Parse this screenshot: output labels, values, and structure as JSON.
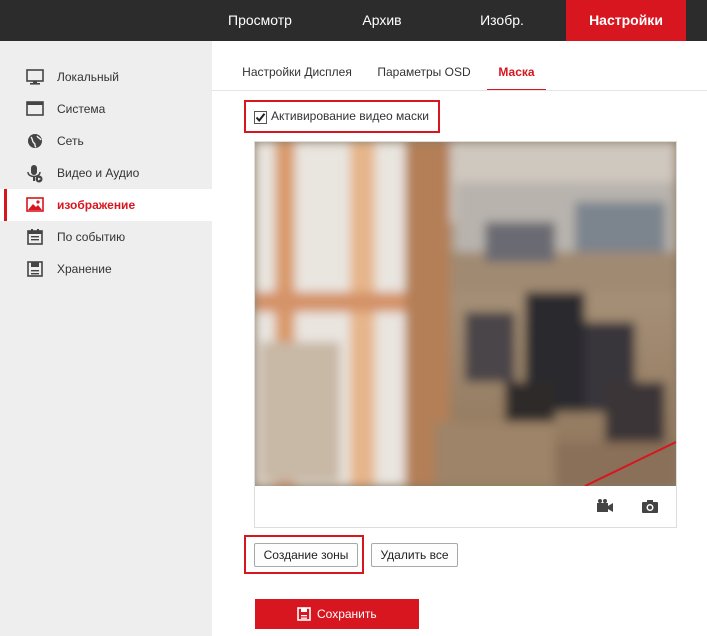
{
  "top_nav": {
    "items": [
      {
        "label": "Просмотр",
        "active": false
      },
      {
        "label": "Архив",
        "active": false
      },
      {
        "label": "Изобр.",
        "active": false
      },
      {
        "label": "Настройки",
        "active": true
      }
    ]
  },
  "sidebar": {
    "items": [
      {
        "label": "Локальный",
        "icon": "monitor-icon",
        "active": false
      },
      {
        "label": "Система",
        "icon": "window-icon",
        "active": false
      },
      {
        "label": "Сеть",
        "icon": "globe-icon",
        "active": false
      },
      {
        "label": "Видео и Аудио",
        "icon": "microphone-icon",
        "active": false
      },
      {
        "label": "изображение",
        "icon": "image-icon",
        "active": true
      },
      {
        "label": "По событию",
        "icon": "calendar-icon",
        "active": false
      },
      {
        "label": "Хранение",
        "icon": "disk-icon",
        "active": false
      }
    ]
  },
  "tabs": [
    {
      "label": "Настройки Дисплея",
      "active": false
    },
    {
      "label": "Параметры OSD",
      "active": false
    },
    {
      "label": "Маска",
      "active": true
    }
  ],
  "mask": {
    "enable_label": "Активирование видео маски",
    "enabled": true
  },
  "video_controls": {
    "record_icon": "video-camera-icon",
    "snapshot_icon": "camera-icon"
  },
  "buttons": {
    "create_zone": "Создание зоны",
    "delete_all": "Удалить все",
    "save": "Сохранить"
  },
  "colors": {
    "accent": "#d7161f",
    "topbar": "#2c2c2c",
    "sidebar": "#eeeeee"
  }
}
